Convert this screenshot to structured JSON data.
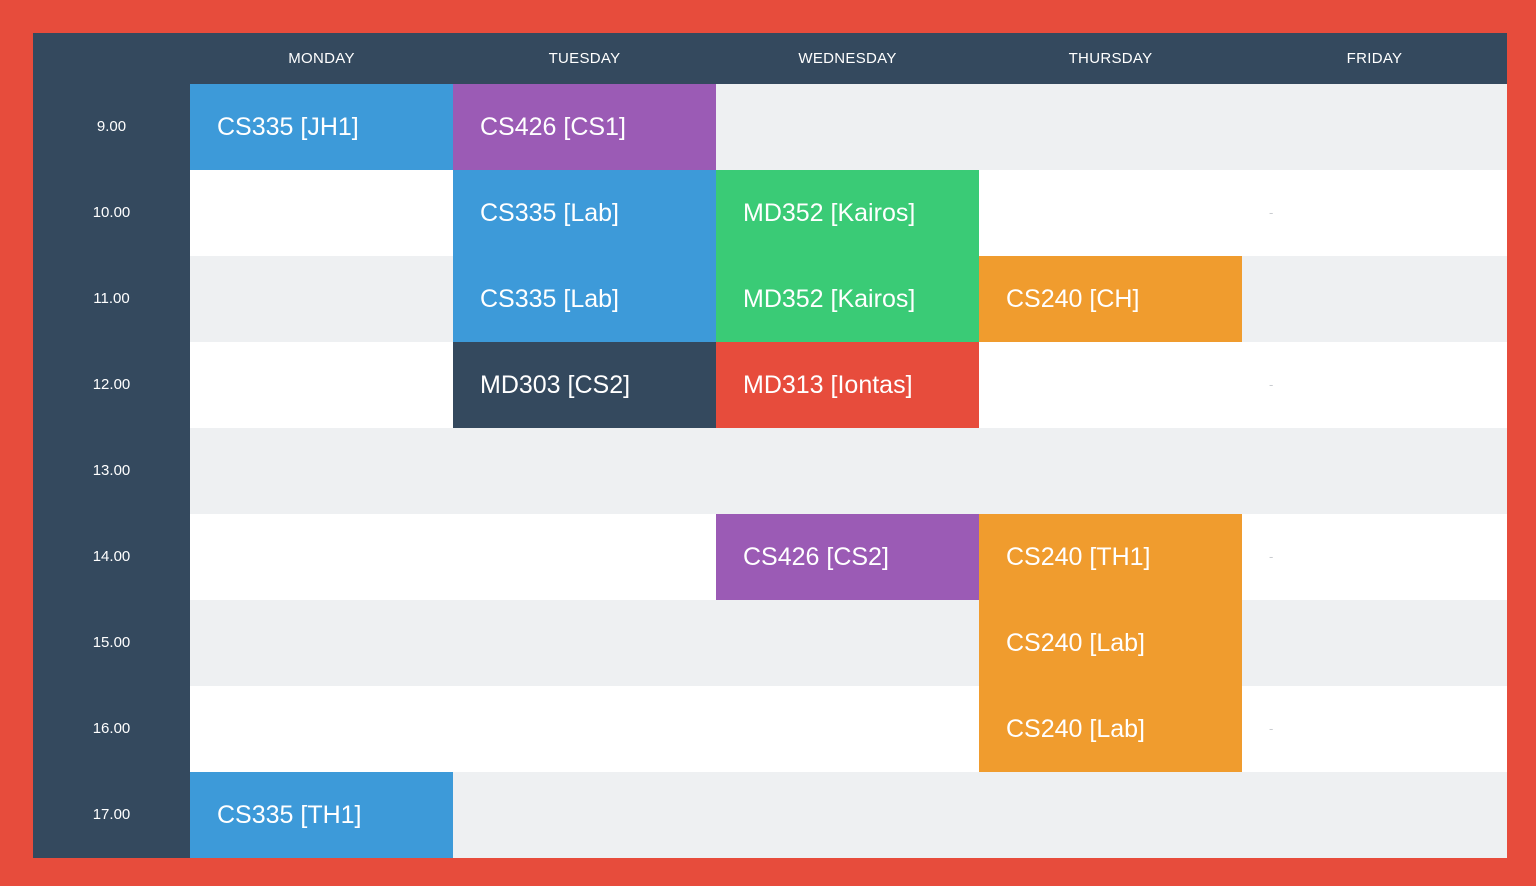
{
  "days": [
    "MONDAY",
    "TUESDAY",
    "WEDNESDAY",
    "THURSDAY",
    "FRIDAY"
  ],
  "times": [
    "9.00",
    "10.00",
    "11.00",
    "12.00",
    "13.00",
    "14.00",
    "15.00",
    "16.00",
    "17.00"
  ],
  "colors": {
    "border": "#e74c3c",
    "frame": "#34495e",
    "row_light": "#eef0f2",
    "row_white": "#ffffff",
    "blue": "#3d9ad9",
    "purple": "#9b5bb5",
    "green": "#3acb76",
    "orange": "#f09c2e",
    "red": "#e74c3c",
    "navy": "#34495e"
  },
  "sessions": [
    {
      "day": 0,
      "time": 0,
      "label": "CS335 [JH1]",
      "color": "blue"
    },
    {
      "day": 1,
      "time": 0,
      "label": "CS426 [CS1]",
      "color": "purple"
    },
    {
      "day": 1,
      "time": 1,
      "label": "CS335 [Lab]",
      "color": "blue"
    },
    {
      "day": 2,
      "time": 1,
      "label": "MD352 [Kairos]",
      "color": "green"
    },
    {
      "day": 1,
      "time": 2,
      "label": "CS335 [Lab]",
      "color": "blue"
    },
    {
      "day": 2,
      "time": 2,
      "label": "MD352 [Kairos]",
      "color": "green"
    },
    {
      "day": 3,
      "time": 2,
      "label": "CS240 [CH]",
      "color": "orange"
    },
    {
      "day": 1,
      "time": 3,
      "label": "MD303 [CS2]",
      "color": "navy"
    },
    {
      "day": 2,
      "time": 3,
      "label": "MD313 [Iontas]",
      "color": "red"
    },
    {
      "day": 2,
      "time": 5,
      "label": "CS426 [CS2]",
      "color": "purple"
    },
    {
      "day": 3,
      "time": 5,
      "label": "CS240 [TH1]",
      "color": "orange"
    },
    {
      "day": 3,
      "time": 6,
      "label": "CS240 [Lab]",
      "color": "orange"
    },
    {
      "day": 3,
      "time": 7,
      "label": "CS240 [Lab]",
      "color": "orange"
    },
    {
      "day": 0,
      "time": 8,
      "label": "CS335 [TH1]",
      "color": "blue"
    }
  ],
  "placeholders": [
    {
      "day": 4,
      "time": 1,
      "label": "-"
    },
    {
      "day": 4,
      "time": 3,
      "label": "-"
    },
    {
      "day": 4,
      "time": 5,
      "label": "-"
    },
    {
      "day": 4,
      "time": 7,
      "label": "-"
    }
  ]
}
